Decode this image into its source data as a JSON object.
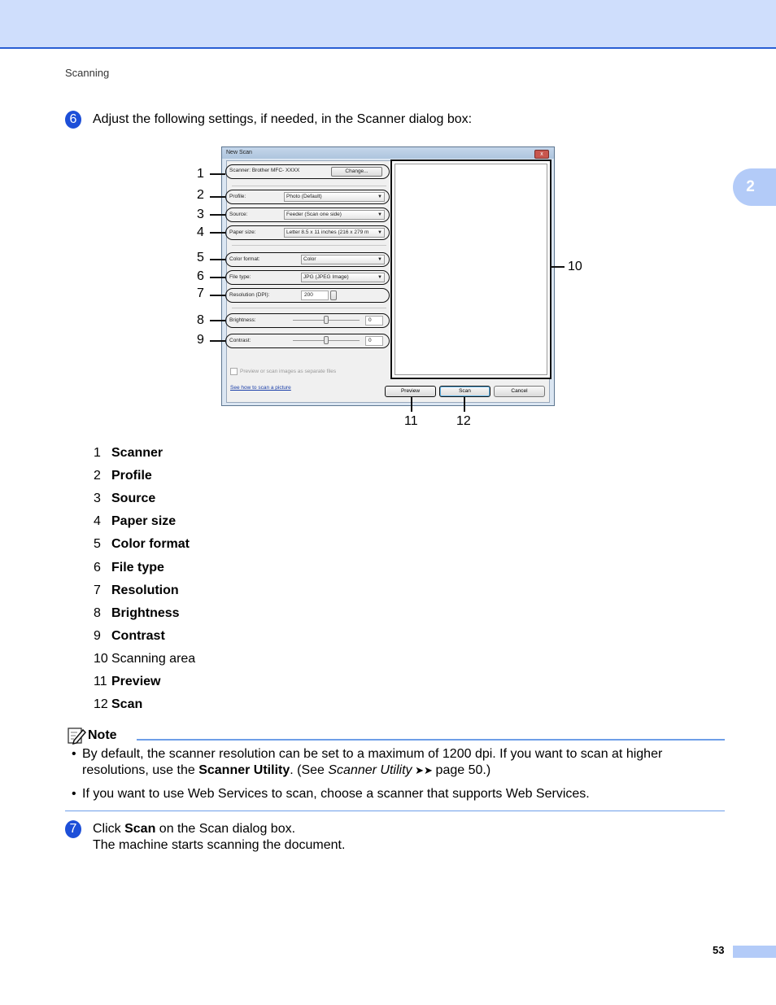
{
  "header": {
    "breadcrumb": "Scanning",
    "chapter_number": "2"
  },
  "step6": {
    "number": "6",
    "text": "Adjust the following settings, if needed, in the Scanner dialog box:"
  },
  "dialog": {
    "title": "New Scan",
    "close_glyph": "x",
    "scanner_label": "Scanner: Brother MFC- XXXX",
    "change_button": "Change...",
    "profile_label": "Profile:",
    "profile_value": "Photo (Default)",
    "source_label": "Source:",
    "source_value": "Feeder (Scan one side)",
    "paper_label": "Paper size:",
    "paper_value": "Letter 8.5 x 11 inches (216 x 279 m",
    "color_label": "Color format:",
    "color_value": "Color",
    "filetype_label": "File type:",
    "filetype_value": "JPG (JPEG Image)",
    "resolution_label": "Resolution (DPI):",
    "resolution_value": "200",
    "brightness_label": "Brightness:",
    "brightness_value": "0",
    "contrast_label": "Contrast:",
    "contrast_value": "0",
    "separate_files_label": "Preview or scan images as separate files",
    "help_link": "See how to scan a picture",
    "preview_button": "Preview",
    "scan_button": "Scan",
    "cancel_button": "Cancel",
    "dropdown_glyph": "▼"
  },
  "callouts": [
    "1",
    "2",
    "3",
    "4",
    "5",
    "6",
    "7",
    "8",
    "9",
    "10",
    "11",
    "12"
  ],
  "legend": [
    {
      "num": "1",
      "label": "Scanner",
      "bold": true
    },
    {
      "num": "2",
      "label": "Profile",
      "bold": true
    },
    {
      "num": "3",
      "label": "Source",
      "bold": true
    },
    {
      "num": "4",
      "label": "Paper size",
      "bold": true
    },
    {
      "num": "5",
      "label": "Color format",
      "bold": true
    },
    {
      "num": "6",
      "label": "File type",
      "bold": true
    },
    {
      "num": "7",
      "label": "Resolution",
      "bold": true
    },
    {
      "num": "8",
      "label": "Brightness",
      "bold": true
    },
    {
      "num": "9",
      "label": "Contrast",
      "bold": true
    },
    {
      "num": "10",
      "label": "Scanning area",
      "bold": false
    },
    {
      "num": "11",
      "label": "Preview",
      "bold": true
    },
    {
      "num": "12",
      "label": "Scan",
      "bold": true
    }
  ],
  "note": {
    "title": "Note",
    "bullet_glyph": "•",
    "bullet1": {
      "line1": "By default, the scanner resolution can be set to a maximum of 1200 dpi. If you want to scan at higher",
      "line2_pre": "resolutions, use the ",
      "line2_bold": "Scanner Utility",
      "line2_mid": ". (See ",
      "line2_italic": "Scanner Utility",
      "line2_arrows": " ➤➤ ",
      "line2_post": "page 50.)"
    },
    "bullet2": "If you want to use Web Services to scan, choose a scanner that supports Web Services."
  },
  "step7": {
    "number": "7",
    "pre": "Click ",
    "bold": "Scan",
    "post": " on the Scan dialog box.",
    "line2": "The machine starts scanning the document."
  },
  "footer": {
    "page_number": "53"
  }
}
